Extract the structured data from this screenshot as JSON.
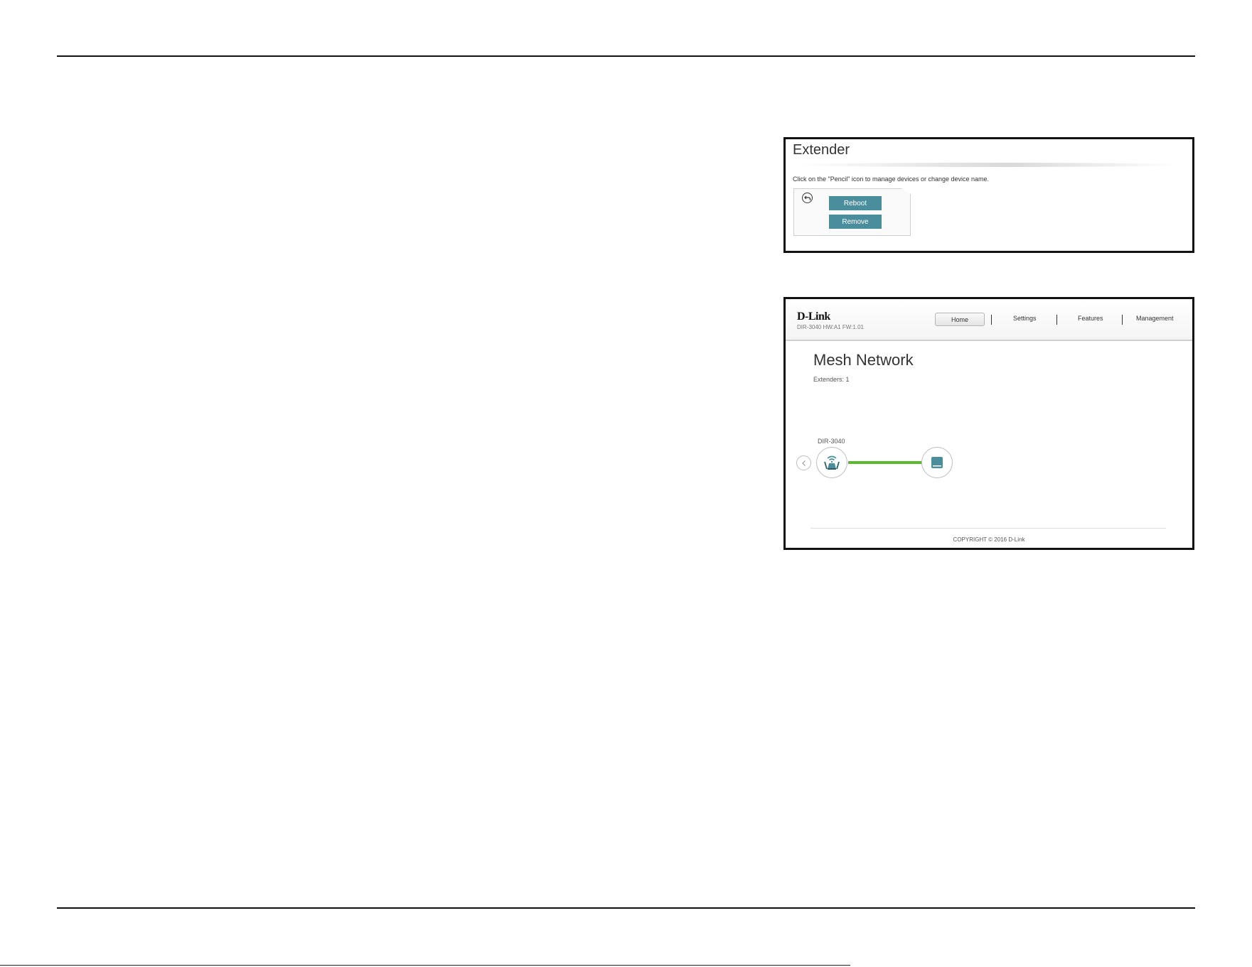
{
  "extender_panel": {
    "title": "Extender",
    "hint": "Click on the \"Pencil\" icon to manage devices or change device name.",
    "back_icon": "back-arrow-icon",
    "reboot_label": "Reboot",
    "remove_label": "Remove",
    "button_color": "#4a8e9e"
  },
  "mesh_panel": {
    "brand": "D-Link",
    "model_info": "DIR-3040 HW:A1 FW:1.01",
    "nav": {
      "home": "Home",
      "settings": "Settings",
      "features": "Features",
      "management": "Management"
    },
    "title": "Mesh Network",
    "extenders_count": "Extenders: 1",
    "router_label": "DIR-3040",
    "router_icon": "router-icon",
    "extender_icon": "extender-icon",
    "prev_icon": "chevron-left-icon",
    "link_color": "#5cb82e",
    "copyright": "COPYRIGHT © 2016 D-Link"
  }
}
